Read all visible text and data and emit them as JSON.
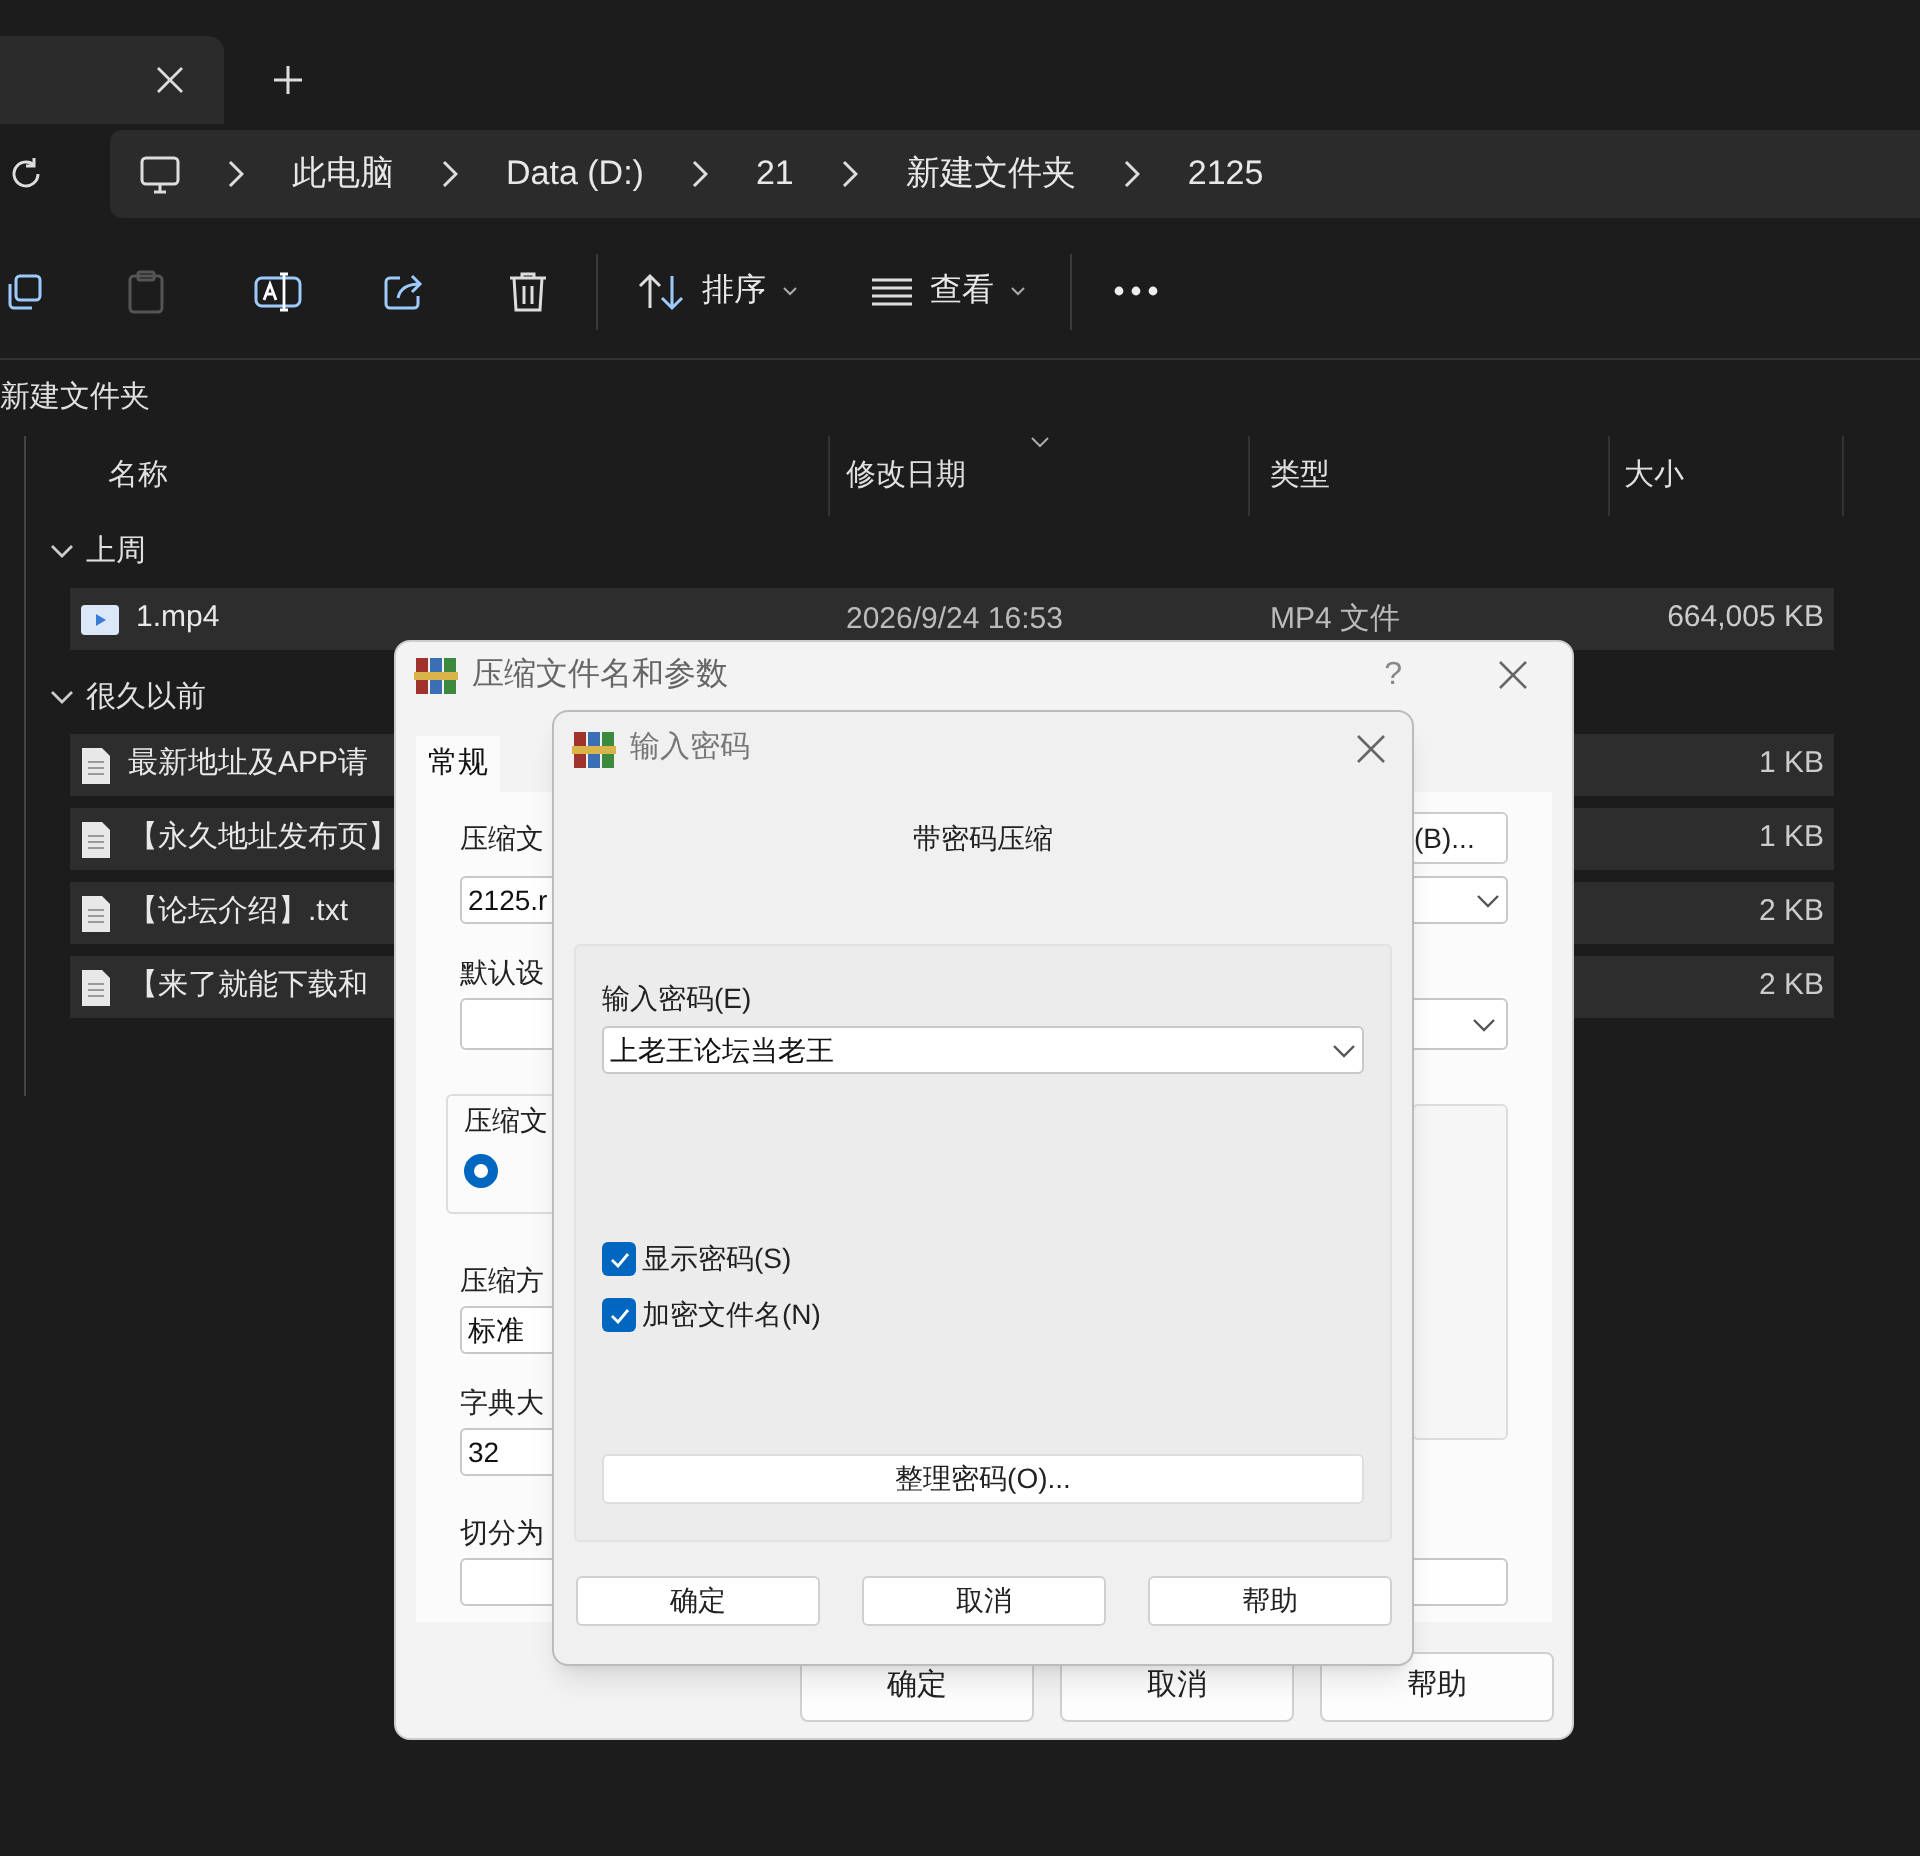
{
  "explorer": {
    "breadcrumb": [
      "此电脑",
      "Data (D:)",
      "21",
      "新建文件夹",
      "2125"
    ],
    "toolbar": {
      "sort_label": "排序",
      "view_label": "查看"
    },
    "folder_title": "新建文件夹",
    "columns": [
      {
        "label": "名称",
        "sorted": false
      },
      {
        "label": "修改日期",
        "sorted": true
      },
      {
        "label": "类型",
        "sorted": false
      },
      {
        "label": "大小",
        "sorted": false
      }
    ],
    "groups": [
      {
        "label": "上周",
        "expanded": true,
        "files": [
          {
            "kind": "video",
            "name": "1.mp4",
            "date": "2026/9/24 16:53",
            "type": "MP4 文件",
            "size": "664,005 KB",
            "selected": true
          }
        ]
      },
      {
        "label": "很久以前",
        "expanded": true,
        "files": [
          {
            "kind": "text",
            "name": "最新地址及APP请",
            "size": "1 KB",
            "selected": true
          },
          {
            "kind": "text",
            "name": "【永久地址发布页】",
            "size": "1 KB",
            "selected": true
          },
          {
            "kind": "text",
            "name": "【论坛介绍】.txt",
            "size": "2 KB",
            "selected": true
          },
          {
            "kind": "text",
            "name": "【来了就能下载和",
            "size": "2 KB",
            "selected": true
          }
        ]
      }
    ]
  },
  "archive_dialog": {
    "title": "压缩文件名和参数",
    "help": "?",
    "tabs": [
      {
        "label": "常规",
        "selected": true
      }
    ],
    "archive_name_label": "压缩文",
    "browse_button": "(B)...",
    "archive_name": "2125.r",
    "profile_label": "默认设",
    "format_group_label": "压缩文",
    "format_radio_selected": true,
    "method_label": "压缩方",
    "method": "标准",
    "dict_label": "字典大",
    "dict": "32",
    "split_label": "切分为",
    "buttons": [
      "确定",
      "取消",
      "帮助"
    ]
  },
  "password_dialog": {
    "title": "输入密码",
    "heading": "带密码压缩",
    "password_label": "输入密码(E)",
    "password": "上老王论坛当老王",
    "options": [
      {
        "label": "显示密码(S)",
        "checked": true
      },
      {
        "label": "加密文件名(N)",
        "checked": true
      }
    ],
    "organize_button": "整理密码(O)...",
    "buttons": [
      "确定",
      "取消",
      "帮助"
    ]
  }
}
